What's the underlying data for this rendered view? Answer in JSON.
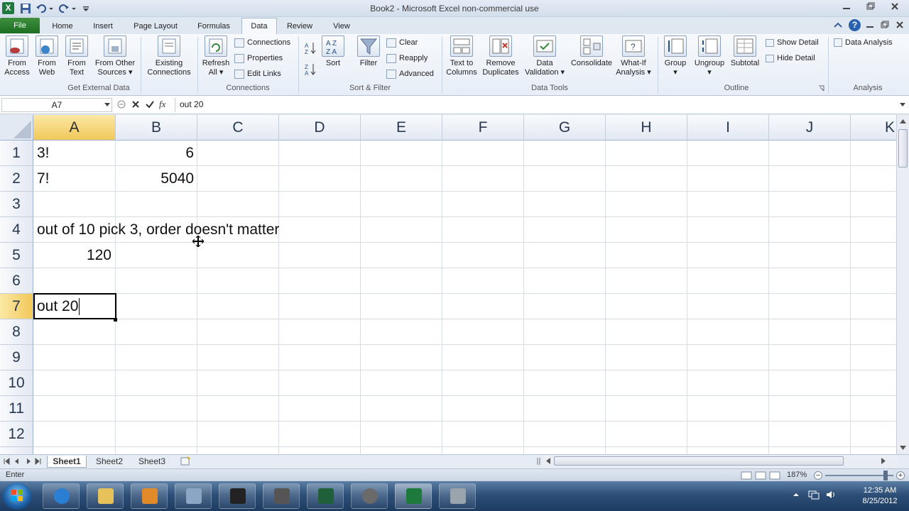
{
  "window": {
    "title": "Book2 - Microsoft Excel non-commercial use",
    "app_icon": "X"
  },
  "tabs": [
    {
      "label": "File"
    },
    {
      "label": "Home"
    },
    {
      "label": "Insert"
    },
    {
      "label": "Page Layout"
    },
    {
      "label": "Formulas"
    },
    {
      "label": "Data"
    },
    {
      "label": "Review"
    },
    {
      "label": "View"
    }
  ],
  "ribbon": {
    "groups": {
      "external": "Get External Data",
      "connections": "Connections",
      "sortfilter": "Sort & Filter",
      "datatools": "Data Tools",
      "outline": "Outline",
      "analysis": "Analysis"
    },
    "buttons": {
      "from_access_1": "From",
      "from_access_2": "Access",
      "from_web_1": "From",
      "from_web_2": "Web",
      "from_text_1": "From",
      "from_text_2": "Text",
      "from_other_1": "From Other",
      "from_other_2": "Sources ▾",
      "existing_1": "Existing",
      "existing_2": "Connections",
      "refresh_1": "Refresh",
      "refresh_2": "All ▾",
      "connections": "Connections",
      "properties": "Properties",
      "edit_links": "Edit Links",
      "sort": "Sort",
      "filter": "Filter",
      "clear": "Clear",
      "reapply": "Reapply",
      "advanced": "Advanced",
      "text_to_cols_1": "Text to",
      "text_to_cols_2": "Columns",
      "remove_dup_1": "Remove",
      "remove_dup_2": "Duplicates",
      "validation_1": "Data",
      "validation_2": "Validation ▾",
      "consolidate": "Consolidate",
      "whatif_1": "What-If",
      "whatif_2": "Analysis ▾",
      "group_1": "Group",
      "group_2": "▾",
      "ungroup_1": "Ungroup",
      "ungroup_2": "▾",
      "subtotal": "Subtotal",
      "show_detail": "Show Detail",
      "hide_detail": "Hide Detail",
      "data_analysis": "Data Analysis"
    }
  },
  "formula_bar": {
    "name_box": "A7",
    "fx": "fx",
    "content": "out 20"
  },
  "columns": [
    "A",
    "B",
    "C",
    "D",
    "E",
    "F",
    "G",
    "H",
    "I",
    "J",
    "K"
  ],
  "rows": [
    "1",
    "2",
    "3",
    "4",
    "5",
    "6",
    "7",
    "8",
    "9",
    "10",
    "11",
    "12"
  ],
  "cells": {
    "A1": "3!",
    "B1": "6",
    "A2": "7!",
    "B2": "5040",
    "A4": "out of 10 pick 3, order doesn't matter",
    "A5": "120",
    "A7": "out 20"
  },
  "sheets": [
    "Sheet1",
    "Sheet2",
    "Sheet3"
  ],
  "status": {
    "mode": "Enter",
    "zoom": "187%"
  },
  "taskbar": {
    "time": "12:35 AM",
    "date": "8/25/2012"
  },
  "colors": {
    "selected_header": "#f1c85a",
    "file_tab": "#2e7d32",
    "excel_green": "#1e7a3c"
  }
}
